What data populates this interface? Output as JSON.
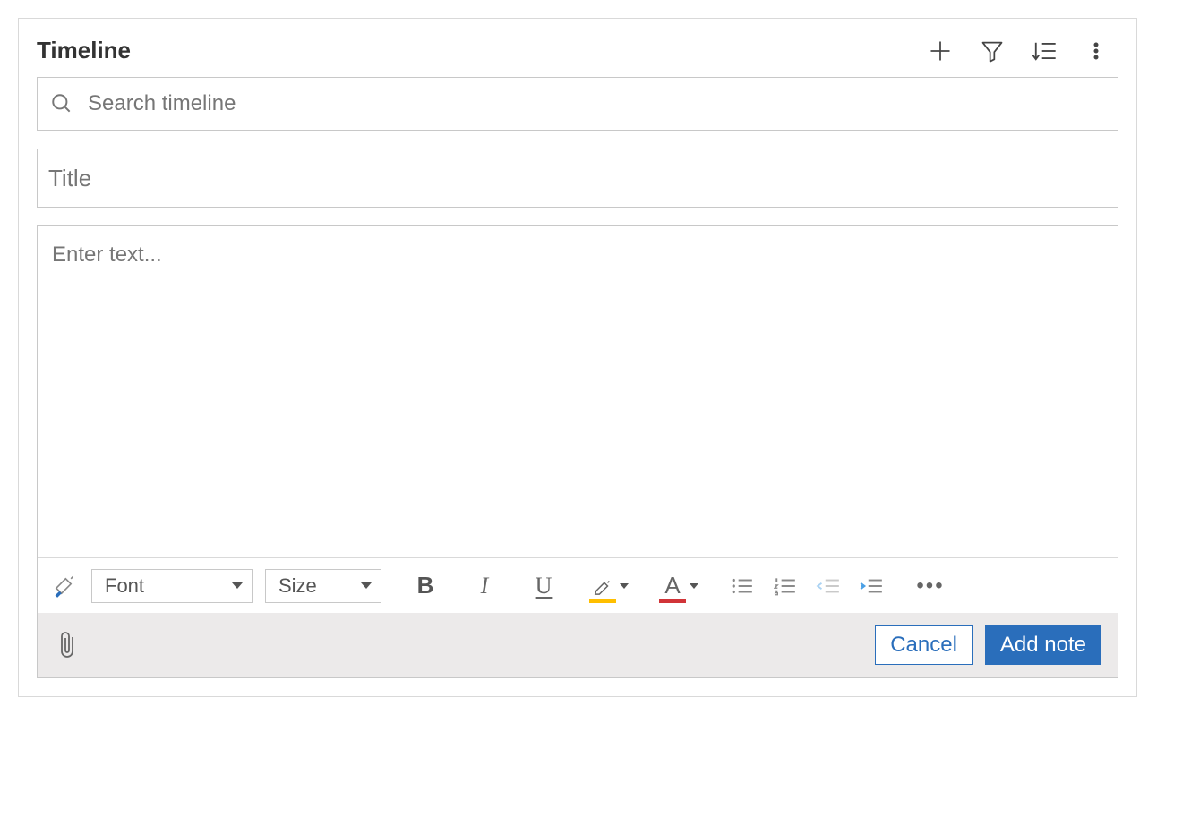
{
  "header": {
    "title": "Timeline"
  },
  "actions": {
    "add": "plus-icon",
    "filter": "filter-icon",
    "sort": "sort-icon",
    "more": "more-vertical-icon"
  },
  "search": {
    "placeholder": "Search timeline",
    "value": ""
  },
  "note": {
    "title_placeholder": "Title",
    "title_value": "",
    "body_placeholder": "Enter text...",
    "body_value": ""
  },
  "toolbar": {
    "format_painter": "format-painter-icon",
    "font_label": "Font",
    "size_label": "Size",
    "bold": "B",
    "italic": "I",
    "underline": "U",
    "highlight_color": "#ffbf00",
    "font_color_letter": "A",
    "font_color": "#d13438",
    "bullet_list": "bullet-list-icon",
    "number_list": "number-list-icon",
    "outdent": "outdent-icon",
    "indent": "indent-icon",
    "more": "…"
  },
  "footer": {
    "attach": "paperclip-icon",
    "cancel_label": "Cancel",
    "submit_label": "Add note"
  }
}
